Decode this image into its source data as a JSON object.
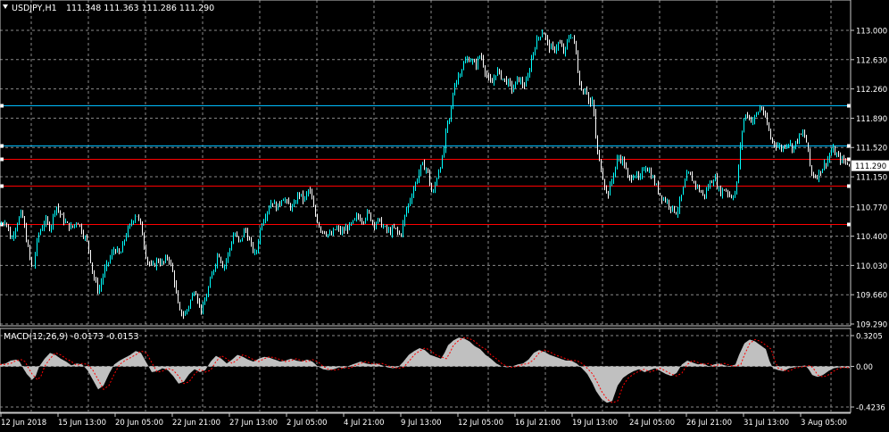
{
  "colors": {
    "background": "#000000",
    "grid": "#8a8a8a",
    "bull": "#00ffff",
    "bear": "#ffffff",
    "level_cyan": "#00bfff",
    "level_red": "#ff0000",
    "macd_hist": "#c0c0c0",
    "macd_signal": "#ff0000",
    "text": "#ffffff"
  },
  "header": {
    "symbol": "USDJPY,H1",
    "ohlc": "111.348 111.363 111.286 111.290"
  },
  "price_axis": {
    "labels": [
      "113.000",
      "112.630",
      "112.260",
      "111.890",
      "111.520",
      "111.150",
      "110.770",
      "110.400",
      "110.030",
      "109.660",
      "109.290"
    ]
  },
  "current_price": {
    "label": "111.290",
    "value": 111.29
  },
  "levels": [
    {
      "color": "cyan",
      "value": 112.05
    },
    {
      "color": "cyan",
      "value": 111.54
    },
    {
      "color": "red",
      "value": 111.38
    },
    {
      "color": "red",
      "value": 111.04
    },
    {
      "color": "red",
      "value": 110.55
    }
  ],
  "macd": {
    "label": "MACD(12,26,9) -0.0173 -0.0153",
    "axis_labels": [
      "0.3205",
      "0.00",
      "-0.4236"
    ]
  },
  "time_axis": {
    "labels": [
      "12 Jun 2018",
      "15 Jun 13:00",
      "20 Jun 05:00",
      "22 Jun 21:00",
      "27 Jun 13:00",
      "2 Jul 05:00",
      "4 Jul 21:00",
      "9 Jul 13:00",
      "12 Jul 05:00",
      "16 Jul 21:00",
      "19 Jul 13:00",
      "24 Jul 05:00",
      "26 Jul 21:00",
      "31 Jul 13:00",
      "3 Aug 05:00"
    ]
  },
  "chart_data": {
    "type": "candlestick",
    "symbol": "USDJPY",
    "timeframe": "H1",
    "ylim": [
      109.25,
      113.15
    ],
    "close_path": [
      [
        0,
        110.55
      ],
      [
        6,
        110.6
      ],
      [
        12,
        110.35
      ],
      [
        18,
        110.55
      ],
      [
        24,
        110.7
      ],
      [
        30,
        110.3
      ],
      [
        36,
        109.95
      ],
      [
        42,
        110.4
      ],
      [
        50,
        110.6
      ],
      [
        56,
        110.5
      ],
      [
        62,
        110.8
      ],
      [
        68,
        110.65
      ],
      [
        74,
        110.55
      ],
      [
        80,
        110.5
      ],
      [
        86,
        110.6
      ],
      [
        92,
        110.45
      ],
      [
        98,
        110.3
      ],
      [
        104,
        109.9
      ],
      [
        110,
        109.7
      ],
      [
        116,
        109.95
      ],
      [
        122,
        110.1
      ],
      [
        128,
        110.25
      ],
      [
        134,
        110.15
      ],
      [
        140,
        110.4
      ],
      [
        146,
        110.55
      ],
      [
        152,
        110.7
      ],
      [
        158,
        110.5
      ],
      [
        164,
        110.1
      ],
      [
        170,
        110.0
      ],
      [
        176,
        110.1
      ],
      [
        182,
        110.05
      ],
      [
        188,
        110.15
      ],
      [
        194,
        109.9
      ],
      [
        200,
        109.45
      ],
      [
        206,
        109.4
      ],
      [
        212,
        109.55
      ],
      [
        218,
        109.75
      ],
      [
        222,
        109.55
      ],
      [
        226,
        109.45
      ],
      [
        232,
        109.7
      ],
      [
        238,
        109.95
      ],
      [
        244,
        110.2
      ],
      [
        250,
        110.0
      ],
      [
        256,
        110.2
      ],
      [
        262,
        110.45
      ],
      [
        268,
        110.3
      ],
      [
        274,
        110.5
      ],
      [
        280,
        110.3
      ],
      [
        286,
        110.15
      ],
      [
        292,
        110.55
      ],
      [
        298,
        110.7
      ],
      [
        304,
        110.85
      ],
      [
        310,
        110.75
      ],
      [
        316,
        110.9
      ],
      [
        322,
        110.8
      ],
      [
        328,
        110.75
      ],
      [
        334,
        110.95
      ],
      [
        340,
        110.85
      ],
      [
        346,
        111.0
      ],
      [
        352,
        110.7
      ],
      [
        358,
        110.5
      ],
      [
        364,
        110.45
      ],
      [
        370,
        110.4
      ],
      [
        376,
        110.5
      ],
      [
        382,
        110.45
      ],
      [
        388,
        110.5
      ],
      [
        394,
        110.55
      ],
      [
        400,
        110.65
      ],
      [
        406,
        110.6
      ],
      [
        412,
        110.7
      ],
      [
        418,
        110.55
      ],
      [
        424,
        110.6
      ],
      [
        430,
        110.5
      ],
      [
        436,
        110.45
      ],
      [
        442,
        110.5
      ],
      [
        448,
        110.4
      ],
      [
        454,
        110.7
      ],
      [
        460,
        110.9
      ],
      [
        466,
        111.1
      ],
      [
        472,
        111.3
      ],
      [
        478,
        111.25
      ],
      [
        484,
        110.9
      ],
      [
        490,
        111.2
      ],
      [
        496,
        111.4
      ],
      [
        500,
        111.8
      ],
      [
        504,
        111.9
      ],
      [
        508,
        112.3
      ],
      [
        514,
        112.45
      ],
      [
        520,
        112.6
      ],
      [
        526,
        112.65
      ],
      [
        532,
        112.55
      ],
      [
        538,
        112.7
      ],
      [
        544,
        112.45
      ],
      [
        550,
        112.3
      ],
      [
        556,
        112.5
      ],
      [
        562,
        112.4
      ],
      [
        568,
        112.35
      ],
      [
        574,
        112.25
      ],
      [
        580,
        112.4
      ],
      [
        586,
        112.3
      ],
      [
        590,
        112.35
      ],
      [
        596,
        112.7
      ],
      [
        602,
        112.9
      ],
      [
        608,
        113.0
      ],
      [
        614,
        112.8
      ],
      [
        620,
        112.75
      ],
      [
        626,
        112.85
      ],
      [
        632,
        112.7
      ],
      [
        636,
        112.9
      ],
      [
        640,
        112.95
      ],
      [
        644,
        112.8
      ],
      [
        648,
        112.4
      ],
      [
        652,
        112.2
      ],
      [
        656,
        112.3
      ],
      [
        660,
        112.05
      ],
      [
        664,
        112.1
      ],
      [
        668,
        111.5
      ],
      [
        672,
        111.3
      ],
      [
        676,
        111.1
      ],
      [
        680,
        110.9
      ],
      [
        686,
        111.15
      ],
      [
        692,
        111.4
      ],
      [
        698,
        111.35
      ],
      [
        704,
        111.1
      ],
      [
        710,
        111.2
      ],
      [
        716,
        111.1
      ],
      [
        722,
        111.3
      ],
      [
        728,
        111.2
      ],
      [
        734,
        111.05
      ],
      [
        740,
        110.9
      ],
      [
        746,
        110.85
      ],
      [
        752,
        110.75
      ],
      [
        758,
        110.7
      ],
      [
        764,
        110.95
      ],
      [
        770,
        111.2
      ],
      [
        776,
        111.1
      ],
      [
        782,
        111.0
      ],
      [
        788,
        110.9
      ],
      [
        794,
        111.05
      ],
      [
        800,
        111.15
      ],
      [
        806,
        110.95
      ],
      [
        812,
        111.0
      ],
      [
        818,
        110.9
      ],
      [
        824,
        110.95
      ],
      [
        828,
        111.4
      ],
      [
        832,
        111.85
      ],
      [
        836,
        111.95
      ],
      [
        842,
        111.85
      ],
      [
        848,
        111.95
      ],
      [
        852,
        112.05
      ],
      [
        858,
        111.85
      ],
      [
        864,
        111.6
      ],
      [
        870,
        111.55
      ],
      [
        876,
        111.5
      ],
      [
        882,
        111.6
      ],
      [
        888,
        111.5
      ],
      [
        894,
        111.65
      ],
      [
        900,
        111.7
      ],
      [
        904,
        111.55
      ],
      [
        908,
        111.2
      ],
      [
        914,
        111.15
      ],
      [
        920,
        111.25
      ],
      [
        926,
        111.35
      ],
      [
        932,
        111.5
      ],
      [
        938,
        111.4
      ],
      [
        944,
        111.35
      ],
      [
        950,
        111.32
      ],
      [
        954,
        111.29
      ]
    ],
    "macd_hist_path": [
      [
        0,
        0.02
      ],
      [
        6,
        0.03
      ],
      [
        12,
        0.06
      ],
      [
        18,
        0.07
      ],
      [
        22,
        0.05
      ],
      [
        26,
        -0.02
      ],
      [
        30,
        -0.08
      ],
      [
        36,
        -0.14
      ],
      [
        40,
        -0.1
      ],
      [
        44,
        0.0
      ],
      [
        50,
        0.08
      ],
      [
        56,
        0.14
      ],
      [
        62,
        0.12
      ],
      [
        68,
        0.08
      ],
      [
        74,
        0.05
      ],
      [
        80,
        0.01
      ],
      [
        86,
        0.03
      ],
      [
        92,
        0.02
      ],
      [
        98,
        -0.04
      ],
      [
        104,
        -0.14
      ],
      [
        110,
        -0.24
      ],
      [
        116,
        -0.2
      ],
      [
        122,
        -0.08
      ],
      [
        128,
        0.02
      ],
      [
        134,
        0.06
      ],
      [
        140,
        0.09
      ],
      [
        146,
        0.12
      ],
      [
        152,
        0.16
      ],
      [
        158,
        0.14
      ],
      [
        164,
        0.04
      ],
      [
        170,
        -0.06
      ],
      [
        176,
        -0.05
      ],
      [
        182,
        -0.02
      ],
      [
        188,
        -0.04
      ],
      [
        194,
        -0.1
      ],
      [
        200,
        -0.18
      ],
      [
        206,
        -0.16
      ],
      [
        212,
        -0.08
      ],
      [
        218,
        -0.03
      ],
      [
        224,
        -0.06
      ],
      [
        230,
        -0.04
      ],
      [
        236,
        0.05
      ],
      [
        242,
        0.11
      ],
      [
        248,
        0.08
      ],
      [
        254,
        0.03
      ],
      [
        260,
        0.07
      ],
      [
        266,
        0.12
      ],
      [
        272,
        0.1
      ],
      [
        278,
        0.07
      ],
      [
        284,
        0.05
      ],
      [
        290,
        0.08
      ],
      [
        296,
        0.1
      ],
      [
        302,
        0.09
      ],
      [
        308,
        0.07
      ],
      [
        314,
        0.05
      ],
      [
        320,
        0.06
      ],
      [
        326,
        0.08
      ],
      [
        332,
        0.06
      ],
      [
        338,
        0.05
      ],
      [
        344,
        0.07
      ],
      [
        350,
        0.05
      ],
      [
        356,
        0.0
      ],
      [
        362,
        -0.03
      ],
      [
        368,
        -0.04
      ],
      [
        374,
        -0.03
      ],
      [
        380,
        -0.01
      ],
      [
        386,
        -0.02
      ],
      [
        392,
        0.01
      ],
      [
        398,
        0.03
      ],
      [
        404,
        0.05
      ],
      [
        410,
        0.03
      ],
      [
        416,
        0.02
      ],
      [
        422,
        0.03
      ],
      [
        428,
        0.01
      ],
      [
        434,
        -0.01
      ],
      [
        440,
        -0.02
      ],
      [
        446,
        -0.01
      ],
      [
        452,
        0.05
      ],
      [
        458,
        0.12
      ],
      [
        464,
        0.16
      ],
      [
        470,
        0.19
      ],
      [
        476,
        0.17
      ],
      [
        482,
        0.12
      ],
      [
        488,
        0.1
      ],
      [
        494,
        0.08
      ],
      [
        498,
        0.14
      ],
      [
        502,
        0.22
      ],
      [
        508,
        0.27
      ],
      [
        514,
        0.3
      ],
      [
        520,
        0.29
      ],
      [
        526,
        0.26
      ],
      [
        532,
        0.21
      ],
      [
        538,
        0.18
      ],
      [
        544,
        0.12
      ],
      [
        550,
        0.08
      ],
      [
        556,
        0.03
      ],
      [
        562,
        0.0
      ],
      [
        568,
        -0.01
      ],
      [
        574,
        0.0
      ],
      [
        580,
        0.02
      ],
      [
        586,
        0.03
      ],
      [
        592,
        0.07
      ],
      [
        598,
        0.14
      ],
      [
        604,
        0.17
      ],
      [
        610,
        0.15
      ],
      [
        616,
        0.12
      ],
      [
        622,
        0.1
      ],
      [
        628,
        0.08
      ],
      [
        634,
        0.06
      ],
      [
        640,
        0.06
      ],
      [
        646,
        0.03
      ],
      [
        652,
        -0.02
      ],
      [
        658,
        -0.08
      ],
      [
        664,
        -0.18
      ],
      [
        668,
        -0.26
      ],
      [
        674,
        -0.34
      ],
      [
        680,
        -0.38
      ],
      [
        686,
        -0.36
      ],
      [
        692,
        -0.2
      ],
      [
        698,
        -0.12
      ],
      [
        704,
        -0.08
      ],
      [
        710,
        -0.05
      ],
      [
        716,
        -0.03
      ],
      [
        722,
        -0.06
      ],
      [
        728,
        -0.04
      ],
      [
        734,
        -0.02
      ],
      [
        740,
        -0.05
      ],
      [
        746,
        -0.08
      ],
      [
        752,
        -0.1
      ],
      [
        758,
        -0.07
      ],
      [
        764,
        0.02
      ],
      [
        770,
        0.06
      ],
      [
        776,
        0.04
      ],
      [
        782,
        0.02
      ],
      [
        788,
        0.03
      ],
      [
        794,
        0.0
      ],
      [
        800,
        0.02
      ],
      [
        806,
        0.03
      ],
      [
        812,
        0.01
      ],
      [
        818,
        0.0
      ],
      [
        824,
        0.02
      ],
      [
        828,
        0.12
      ],
      [
        834,
        0.24
      ],
      [
        840,
        0.28
      ],
      [
        846,
        0.26
      ],
      [
        852,
        0.22
      ],
      [
        858,
        0.18
      ],
      [
        862,
        0.06
      ],
      [
        866,
        -0.02
      ],
      [
        872,
        -0.04
      ],
      [
        878,
        -0.05
      ],
      [
        884,
        -0.02
      ],
      [
        890,
        -0.01
      ],
      [
        896,
        0.0
      ],
      [
        902,
        0.01
      ],
      [
        906,
        -0.03
      ],
      [
        910,
        -0.09
      ],
      [
        916,
        -0.11
      ],
      [
        922,
        -0.09
      ],
      [
        928,
        -0.05
      ],
      [
        934,
        -0.02
      ],
      [
        940,
        -0.01
      ],
      [
        946,
        -0.015
      ],
      [
        952,
        -0.017
      ]
    ]
  }
}
